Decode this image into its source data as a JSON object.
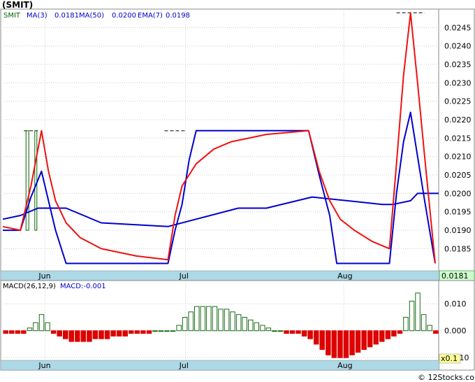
{
  "title": "(SMIT)",
  "legend": {
    "symbol": "SMIT",
    "ma3": "MA(3)",
    "ma3_value": "0.0181",
    "ma50": "MA(50)",
    "ma50_value": "0.0200",
    "ema7": "EMA(7)",
    "ema7_value": "0.0198"
  },
  "price_badge": "0.0181",
  "macd_legend": {
    "label": "MACD(26,12,9)",
    "value": "MACD:-0.001"
  },
  "macd_scale_badge": "x0.1",
  "watermark": "© 12Stocks.com",
  "colors": {
    "price": "#006400",
    "ma3": "#0000cc",
    "ema7": "#ee1111",
    "macd_pos": "#1a6b1a",
    "macd_neg": "#dd0000",
    "axis_band": "#add8e6",
    "badge_bg": "#ccffcc"
  },
  "chart_data": [
    {
      "type": "line",
      "title": "(SMIT)",
      "x_ticks": [
        "Jun",
        "Jul",
        "Aug"
      ],
      "x_tick_index": [
        12,
        52,
        97
      ],
      "y_ticks": [
        "0.0185",
        "0.0190",
        "0.0195",
        "0.0200",
        "0.0205",
        "0.0210",
        "0.0215",
        "0.0220",
        "0.0225",
        "0.0230",
        "0.0235",
        "0.0240",
        "0.0245"
      ],
      "ylim": [
        0.0179,
        0.025
      ],
      "grid": true,
      "series": [
        {
          "name": "SMIT",
          "style": "ohlc",
          "points": [
            [
              0,
              0.019
            ],
            [
              4,
              0.019
            ],
            [
              6,
              0.0217
            ],
            [
              10,
              0.0217
            ],
            [
              46,
              0.0217
            ],
            [
              52,
              0.0217
            ],
            [
              112,
              0.0249
            ],
            [
              120,
              0.0249
            ]
          ]
        },
        {
          "name": "MA(3)",
          "points": [
            [
              0,
              0.019
            ],
            [
              5,
              0.019
            ],
            [
              8,
              0.0199
            ],
            [
              11,
              0.0206
            ],
            [
              13,
              0.0198
            ],
            [
              15,
              0.019
            ],
            [
              18,
              0.0181
            ],
            [
              47,
              0.0181
            ],
            [
              49,
              0.019
            ],
            [
              51,
              0.0197
            ],
            [
              53,
              0.0209
            ],
            [
              55,
              0.0217
            ],
            [
              87,
              0.0217
            ],
            [
              90,
              0.0205
            ],
            [
              93,
              0.0194
            ],
            [
              95,
              0.0181
            ],
            [
              110,
              0.0181
            ],
            [
              112,
              0.02
            ],
            [
              114,
              0.0214
            ],
            [
              116,
              0.0222
            ],
            [
              118,
              0.021
            ],
            [
              120,
              0.0198
            ],
            [
              123,
              0.0181
            ]
          ]
        },
        {
          "name": "MA(50)",
          "points": [
            [
              0,
              0.0193
            ],
            [
              5,
              0.0194
            ],
            [
              10,
              0.0196
            ],
            [
              18,
              0.0196
            ],
            [
              28,
              0.0192
            ],
            [
              47,
              0.0191
            ],
            [
              67,
              0.0196
            ],
            [
              75,
              0.0196
            ],
            [
              88,
              0.0199
            ],
            [
              108,
              0.0197
            ],
            [
              111,
              0.0197
            ],
            [
              116,
              0.0198
            ],
            [
              118,
              0.02
            ],
            [
              124,
              0.02
            ]
          ]
        },
        {
          "name": "EMA(7)",
          "points": [
            [
              0,
              0.0191
            ],
            [
              5,
              0.019
            ],
            [
              8,
              0.0202
            ],
            [
              11,
              0.0217
            ],
            [
              13,
              0.0206
            ],
            [
              15,
              0.0198
            ],
            [
              18,
              0.0192
            ],
            [
              22,
              0.0188
            ],
            [
              28,
              0.0185
            ],
            [
              38,
              0.0183
            ],
            [
              47,
              0.0182
            ],
            [
              49,
              0.0194
            ],
            [
              51,
              0.0202
            ],
            [
              55,
              0.0208
            ],
            [
              60,
              0.0212
            ],
            [
              65,
              0.0214
            ],
            [
              70,
              0.0215
            ],
            [
              75,
              0.0216
            ],
            [
              87,
              0.0217
            ],
            [
              90,
              0.0206
            ],
            [
              93,
              0.0198
            ],
            [
              96,
              0.0193
            ],
            [
              100,
              0.019
            ],
            [
              105,
              0.0187
            ],
            [
              110,
              0.0185
            ],
            [
              112,
              0.0208
            ],
            [
              114,
              0.0232
            ],
            [
              116,
              0.0249
            ],
            [
              118,
              0.023
            ],
            [
              120,
              0.021
            ],
            [
              123,
              0.0181
            ]
          ]
        }
      ]
    },
    {
      "type": "bar",
      "title": "MACD(26,12,9)",
      "x_ticks": [
        "Jun",
        "Jul",
        "Aug"
      ],
      "x_tick_index": [
        12,
        52,
        97
      ],
      "y_ticks": [
        "0.010",
        "0.000",
        "-0.010"
      ],
      "ylim": [
        -0.011,
        0.015
      ],
      "values": [
        -0.001,
        -0.001,
        -0.001,
        -0.001,
        0.001,
        0.003,
        0.006,
        0.003,
        -0.001,
        -0.002,
        -0.003,
        -0.004,
        -0.004,
        -0.004,
        -0.004,
        -0.003,
        -0.003,
        -0.003,
        -0.002,
        -0.002,
        -0.002,
        -0.001,
        -0.001,
        -0.001,
        -0.001,
        0.0,
        0.0,
        0.0,
        0.0,
        0.002,
        0.005,
        0.007,
        0.009,
        0.009,
        0.009,
        0.009,
        0.008,
        0.008,
        0.007,
        0.006,
        0.005,
        0.004,
        0.003,
        0.002,
        0.001,
        0.0,
        0.0,
        -0.001,
        -0.001,
        -0.001,
        -0.002,
        -0.003,
        -0.005,
        -0.007,
        -0.009,
        -0.01,
        -0.01,
        -0.01,
        -0.009,
        -0.008,
        -0.007,
        -0.006,
        -0.005,
        -0.004,
        -0.003,
        -0.002,
        -0.001,
        0.005,
        0.011,
        0.014,
        0.006,
        0.002,
        -0.001
      ]
    }
  ]
}
